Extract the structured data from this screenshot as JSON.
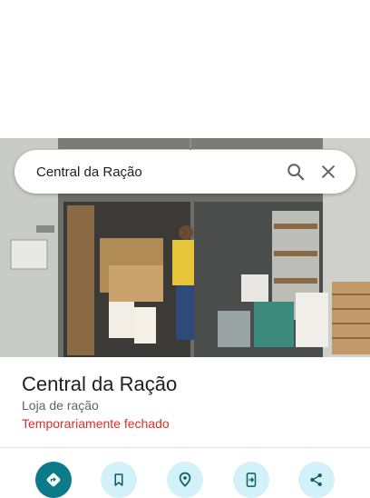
{
  "search": {
    "query": "Central da Ração"
  },
  "place": {
    "name": "Central da Ração",
    "category": "Loja de ração",
    "status": "Temporariamente fechado"
  },
  "icons": {
    "search": "search-icon",
    "close": "close-icon",
    "directions": "directions-icon",
    "save": "bookmark-icon",
    "nearby": "nearby-icon",
    "send_to_phone": "send-to-phone-icon",
    "share": "share-icon"
  },
  "colors": {
    "accent": "#0b7b8a",
    "action_bg": "#d2f1f9",
    "status_closed": "#d93025"
  }
}
